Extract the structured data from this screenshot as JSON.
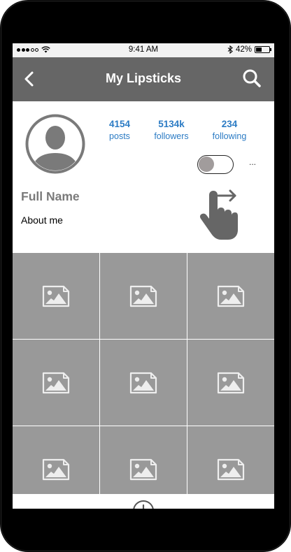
{
  "status_bar": {
    "time": "9:41 AM",
    "battery": "42%",
    "battery_level": 0.42
  },
  "nav": {
    "title": "My Lipsticks",
    "back_icon": "chevron-left-icon",
    "search_icon": "search-icon"
  },
  "profile": {
    "stats": [
      {
        "value": "4154",
        "label": "posts"
      },
      {
        "value": "5134k",
        "label": "followers"
      },
      {
        "value": "234",
        "label": "following"
      }
    ],
    "full_name": "Full Name",
    "about": "About me",
    "more": "...",
    "toggle_on": false
  },
  "grid": {
    "item_count": 9,
    "item_icon": "image-placeholder-icon"
  },
  "colors": {
    "nav_bg": "#666666",
    "stat_blue": "#2b7bc4",
    "grid_gray": "#999999",
    "name_gray": "#7a7a7a"
  }
}
